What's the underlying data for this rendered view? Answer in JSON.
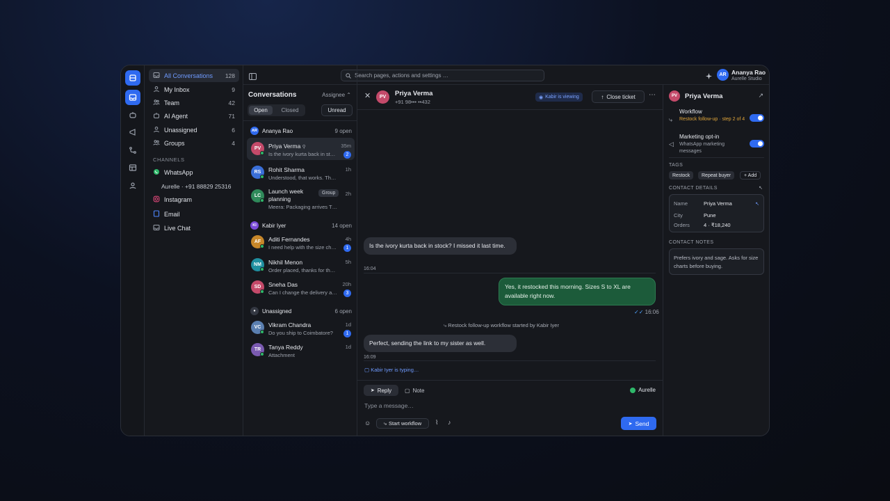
{
  "topbar": {
    "search_placeholder": "Search pages, actions and settings …",
    "user_initials": "AR",
    "user_name": "Ananya Rao",
    "user_company": "Aurelle Studio"
  },
  "nav": {
    "items": [
      {
        "label": "All Conversations",
        "count": "128"
      },
      {
        "label": "My Inbox",
        "count": "9"
      },
      {
        "label": "Team",
        "count": "42"
      },
      {
        "label": "AI Agent",
        "count": "71"
      },
      {
        "label": "Unassigned",
        "count": "6"
      },
      {
        "label": "Groups",
        "count": "4"
      }
    ],
    "channels_heading": "CHANNELS",
    "channels": [
      {
        "label": "WhatsApp"
      },
      {
        "label": "Instagram"
      },
      {
        "label": "Email"
      },
      {
        "label": "Live Chat"
      }
    ],
    "whatsapp_number": "Aurelle · +91 88829 25316"
  },
  "conversations": {
    "title": "Conversations",
    "sort_label": "Assignee",
    "tab_open": "Open",
    "tab_closed": "Closed",
    "unread_label": "Unread",
    "groups": [
      {
        "initials": "AR",
        "name": "Ananya Rao",
        "open": "9 open",
        "items": [
          {
            "initials": "PV",
            "name": "Priya Verma",
            "preview": "Is the ivory kurta back in st…",
            "time": "35m",
            "badge": "2",
            "color": "#c44a6a"
          },
          {
            "initials": "RS",
            "name": "Rohit Sharma",
            "preview": "Understood, that works. Th…",
            "time": "1h",
            "badge": "",
            "color": "#3a6fd8"
          },
          {
            "initials": "LC",
            "name": "Launch week planning",
            "preview": "Meera: Packaging arrives T…",
            "time": "2h",
            "badge": "",
            "color": "#2f8a5a",
            "group_tag": "Group"
          }
        ]
      },
      {
        "initials": "KI",
        "name": "Kabir Iyer",
        "open": "14 open",
        "items": [
          {
            "initials": "AF",
            "name": "Aditi Fernandes",
            "preview": "I need help with the size ch…",
            "time": "4h",
            "badge": "1",
            "color": "#c7872a"
          },
          {
            "initials": "NM",
            "name": "Nikhil Menon",
            "preview": "Order placed, thanks for th…",
            "time": "5h",
            "badge": "",
            "color": "#1f8fa0"
          },
          {
            "initials": "SD",
            "name": "Sneha Das",
            "preview": "Can I change the delivery a…",
            "time": "20h",
            "badge": "3",
            "color": "#c44a6a"
          }
        ]
      },
      {
        "initials": "",
        "name": "Unassigned",
        "open": "6 open",
        "items": [
          {
            "initials": "VC",
            "name": "Vikram Chandra",
            "preview": "Do you ship to Coimbatore?",
            "time": "1d",
            "badge": "1",
            "color": "#5a7fb0"
          },
          {
            "initials": "TR",
            "name": "Tanya Reddy",
            "preview": "Attachment",
            "time": "1d",
            "badge": "",
            "color": "#7a5ab0"
          }
        ]
      }
    ]
  },
  "chat": {
    "contact_initials": "PV",
    "contact_name": "Priya Verma",
    "contact_phone": "+91 98••• ••432",
    "viewing": "Kabir is viewing",
    "close_label": "Close ticket",
    "msg1": "Is the ivory kurta back in stock? I missed it last time.",
    "t1": "16:04",
    "msg2": "Yes, it restocked this morning. Sizes S to XL are available right now.",
    "t2": "16:06",
    "system": "Restock follow-up workflow started by Kabir Iyer",
    "msg3": "Perfect, sending the link to my sister as well.",
    "t3": "16:09",
    "typing": "Kabir Iyer is typing…",
    "reply_tab": "Reply",
    "note_tab": "Note",
    "channel": "Aurelle",
    "placeholder": "Type a message…",
    "workflow_btn": "Start workflow",
    "send": "Send"
  },
  "detail": {
    "initials": "PV",
    "name": "Priya Verma",
    "workflow_title": "Workflow",
    "workflow_sub": "Restock follow-up · step 2 of 4",
    "optin_title": "Marketing opt-in",
    "optin_sub": "WhatsApp marketing messages",
    "tags_label": "TAGS",
    "tags": [
      "Restock",
      "Repeat buyer",
      "+ Add"
    ],
    "contact_label": "CONTACT DETAILS",
    "name_k": "Name",
    "name_v": "Priya Verma",
    "city_k": "City",
    "city_v": "Pune",
    "orders_k": "Orders",
    "orders_v": "4 · ₹18,240",
    "notes_label": "CONTACT NOTES",
    "notes": "Prefers ivory and sage. Asks for size charts before buying.",
    "colors": {
      "accent": "#2f6af0",
      "outgoing": "#1c5b3a",
      "warning": "#e0a53a"
    }
  }
}
